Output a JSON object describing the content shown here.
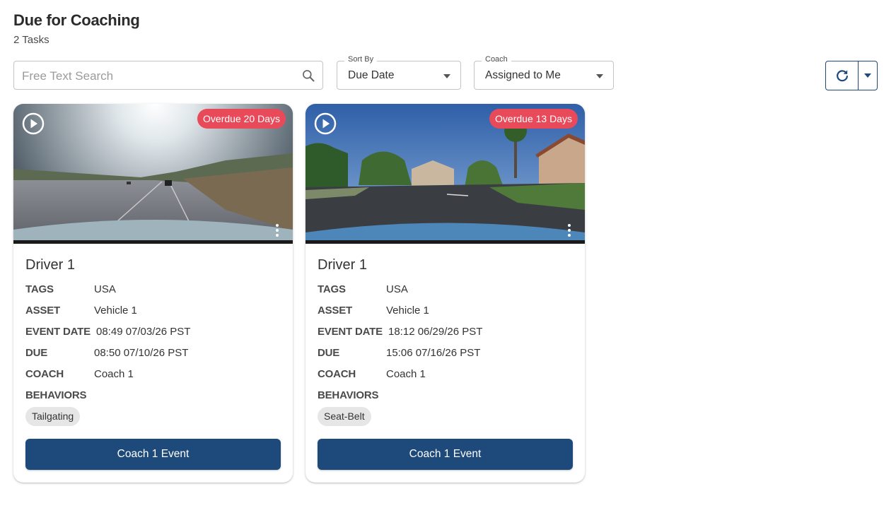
{
  "header": {
    "title": "Due for Coaching",
    "task_count": "2 Tasks"
  },
  "filters": {
    "search": {
      "placeholder": "Free Text Search",
      "value": ""
    },
    "sort_by": {
      "label": "Sort By",
      "value": "Due Date"
    },
    "coach": {
      "label": "Coach",
      "value": "Assigned to Me"
    }
  },
  "labels": {
    "tags": "TAGS",
    "asset": "ASSET",
    "event_date": "EVENT DATE",
    "due": "DUE",
    "coach": "COACH",
    "behaviors": "BEHAVIORS"
  },
  "cards": [
    {
      "overdue": "Overdue 20 Days",
      "driver": "Driver 1",
      "tags": "USA",
      "asset": "Vehicle 1",
      "event_date": "08:49 07/03/26 PST",
      "due": "08:50 07/10/26 PST",
      "coach": "Coach 1",
      "behaviors": [
        "Tailgating"
      ],
      "cta": "Coach 1 Event",
      "scene": "highway"
    },
    {
      "overdue": "Overdue 13 Days",
      "driver": "Driver 1",
      "tags": "USA",
      "asset": "Vehicle 1",
      "event_date": "18:12 06/29/26 PST",
      "due": "15:06 07/16/26 PST",
      "coach": "Coach 1",
      "behaviors": [
        "Seat-Belt"
      ],
      "cta": "Coach 1 Event",
      "scene": "residential"
    }
  ],
  "colors": {
    "primary": "#1d4a7a",
    "overdue_badge": "#e84a5a",
    "chip": "#e6e6e6"
  },
  "icons": [
    "search-icon",
    "chevron-down-icon",
    "refresh-icon",
    "play-icon",
    "more-vertical-icon"
  ]
}
